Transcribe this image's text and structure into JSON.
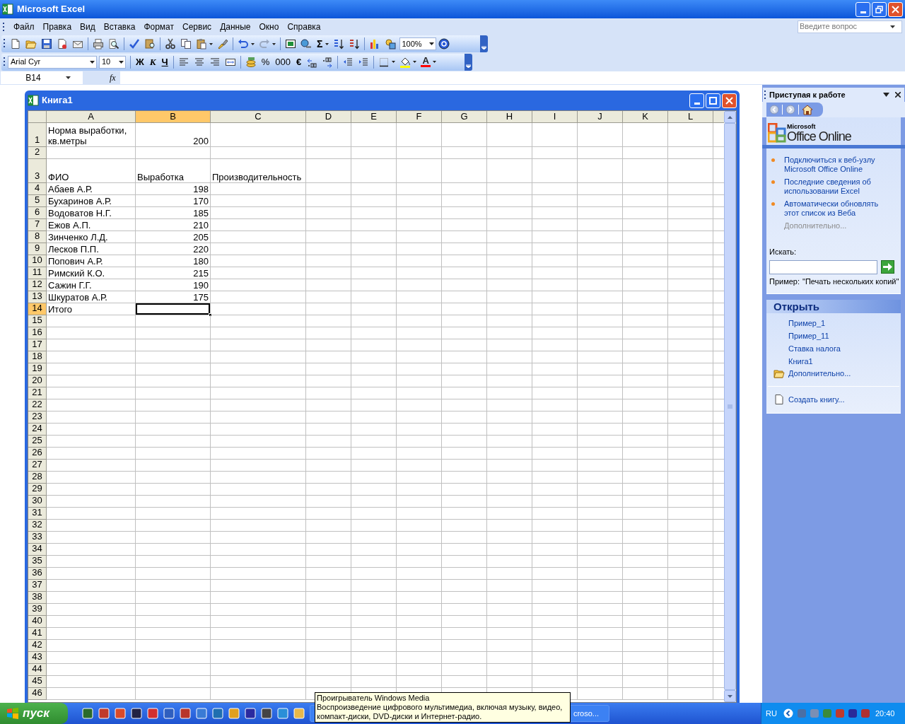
{
  "window": {
    "title": "Microsoft Excel"
  },
  "menu": [
    {
      "label": "Файл"
    },
    {
      "label": "Правка"
    },
    {
      "label": "Вид"
    },
    {
      "label": "Вставка"
    },
    {
      "label": "Формат"
    },
    {
      "label": "Сервис"
    },
    {
      "label": "Данные"
    },
    {
      "label": "Окно"
    },
    {
      "label": "Справка"
    }
  ],
  "help_search": {
    "placeholder": "Введите вопрос"
  },
  "standard_toolbar": {
    "autosum": "Σ",
    "zoom": "100%"
  },
  "formatting_toolbar": {
    "font": "Arial Cyr",
    "size": "10",
    "bold": "Ж",
    "italic": "К",
    "underline": "Ч",
    "percent": "%",
    "thousands": "000",
    "euro": "€",
    "font_color": "A"
  },
  "formula_bar": {
    "name_box": "B14",
    "function_label": "fx"
  },
  "workbook": {
    "title": "Книга1",
    "columns": [
      {
        "label": "A",
        "selected": false
      },
      {
        "label": "B",
        "selected": true
      },
      {
        "label": "C",
        "selected": false
      },
      {
        "label": "D",
        "selected": false
      },
      {
        "label": "E",
        "selected": false
      },
      {
        "label": "F",
        "selected": false
      },
      {
        "label": "G",
        "selected": false
      },
      {
        "label": "H",
        "selected": false
      },
      {
        "label": "I",
        "selected": false
      },
      {
        "label": "J",
        "selected": false
      },
      {
        "label": "K",
        "selected": false
      },
      {
        "label": "L",
        "selected": false
      }
    ],
    "rows": [
      {
        "header": "1",
        "tall": true,
        "selected": false,
        "cells": [
          {
            "text": "Норма выработки, кв.метры",
            "kind": "text"
          },
          {
            "text": "200",
            "kind": "number"
          }
        ]
      },
      {
        "header": "2",
        "tall": false,
        "selected": false
      },
      {
        "header": "3",
        "tall": true,
        "selected": false,
        "cells": [
          {
            "text": "ФИО",
            "kind": "text"
          },
          {
            "text": "Выработка",
            "kind": "text"
          },
          {
            "text": "Производительность",
            "kind": "text"
          }
        ]
      },
      {
        "header": "4",
        "tall": false,
        "selected": false,
        "cells": [
          {
            "text": "Абаев А.Р.",
            "kind": "text"
          },
          {
            "text": "198",
            "kind": "number"
          }
        ]
      },
      {
        "header": "5",
        "tall": false,
        "selected": false,
        "cells": [
          {
            "text": "Бухаринов А.Р.",
            "kind": "text"
          },
          {
            "text": "170",
            "kind": "number"
          }
        ]
      },
      {
        "header": "6",
        "tall": false,
        "selected": false,
        "cells": [
          {
            "text": "Водоватов Н.Г.",
            "kind": "text"
          },
          {
            "text": "185",
            "kind": "number"
          }
        ]
      },
      {
        "header": "7",
        "tall": false,
        "selected": false,
        "cells": [
          {
            "text": "Ежов А.П.",
            "kind": "text"
          },
          {
            "text": "210",
            "kind": "number"
          }
        ]
      },
      {
        "header": "8",
        "tall": false,
        "selected": false,
        "cells": [
          {
            "text": "Зинченко Л.Д.",
            "kind": "text"
          },
          {
            "text": "205",
            "kind": "number"
          }
        ]
      },
      {
        "header": "9",
        "tall": false,
        "selected": false,
        "cells": [
          {
            "text": "Лесков П.П.",
            "kind": "text"
          },
          {
            "text": "220",
            "kind": "number"
          }
        ]
      },
      {
        "header": "10",
        "tall": false,
        "selected": false,
        "cells": [
          {
            "text": "Попович А.Р.",
            "kind": "text"
          },
          {
            "text": "180",
            "kind": "number"
          }
        ]
      },
      {
        "header": "11",
        "tall": false,
        "selected": false,
        "cells": [
          {
            "text": "Римский К.О.",
            "kind": "text"
          },
          {
            "text": "215",
            "kind": "number"
          }
        ]
      },
      {
        "header": "12",
        "tall": false,
        "selected": false,
        "cells": [
          {
            "text": "Сажин Г.Г.",
            "kind": "text"
          },
          {
            "text": "190",
            "kind": "number"
          }
        ]
      },
      {
        "header": "13",
        "tall": false,
        "selected": false,
        "cells": [
          {
            "text": "Шкуратов А.Р.",
            "kind": "text"
          },
          {
            "text": "175",
            "kind": "number"
          }
        ]
      },
      {
        "header": "14",
        "tall": false,
        "selected": true,
        "cells": [
          {
            "text": "Итого",
            "kind": "text"
          }
        ]
      },
      {
        "header": "15",
        "tall": false,
        "selected": false
      },
      {
        "header": "16",
        "tall": false,
        "selected": false
      },
      {
        "header": "17",
        "tall": false,
        "selected": false
      },
      {
        "header": "18",
        "tall": false,
        "selected": false
      },
      {
        "header": "19",
        "tall": false,
        "selected": false
      },
      {
        "header": "20",
        "tall": false,
        "selected": false
      },
      {
        "header": "21",
        "tall": false,
        "selected": false
      },
      {
        "header": "22",
        "tall": false,
        "selected": false
      },
      {
        "header": "23",
        "tall": false,
        "selected": false
      },
      {
        "header": "24",
        "tall": false,
        "selected": false
      },
      {
        "header": "25",
        "tall": false,
        "selected": false
      },
      {
        "header": "26",
        "tall": false,
        "selected": false
      },
      {
        "header": "27",
        "tall": false,
        "selected": false
      },
      {
        "header": "28",
        "tall": false,
        "selected": false
      },
      {
        "header": "29",
        "tall": false,
        "selected": false
      },
      {
        "header": "30",
        "tall": false,
        "selected": false
      },
      {
        "header": "31",
        "tall": false,
        "selected": false
      },
      {
        "header": "32",
        "tall": false,
        "selected": false
      },
      {
        "header": "33",
        "tall": false,
        "selected": false
      },
      {
        "header": "34",
        "tall": false,
        "selected": false
      },
      {
        "header": "35",
        "tall": false,
        "selected": false
      },
      {
        "header": "36",
        "tall": false,
        "selected": false
      },
      {
        "header": "37",
        "tall": false,
        "selected": false
      },
      {
        "header": "38",
        "tall": false,
        "selected": false
      },
      {
        "header": "39",
        "tall": false,
        "selected": false
      },
      {
        "header": "40",
        "tall": false,
        "selected": false
      },
      {
        "header": "41",
        "tall": false,
        "selected": false
      },
      {
        "header": "42",
        "tall": false,
        "selected": false
      },
      {
        "header": "43",
        "tall": false,
        "selected": false
      },
      {
        "header": "44",
        "tall": false,
        "selected": false
      },
      {
        "header": "45",
        "tall": false,
        "selected": false
      },
      {
        "header": "46",
        "tall": false,
        "selected": false
      }
    ]
  },
  "task_pane": {
    "title": "Приступая к работе",
    "logo_brand": "Microsoft",
    "logo_name": "Office Online",
    "links": [
      {
        "label": "Подключиться к веб-узлу Microsoft Office Online",
        "disabled": false
      },
      {
        "label": "Последние сведения об использовании Excel",
        "disabled": false
      },
      {
        "label": "Автоматически обновлять этот список из Веба",
        "disabled": false
      },
      {
        "label": "Дополнительно...",
        "disabled": true
      }
    ],
    "search_label": "Искать:",
    "example_label": "Пример:",
    "example_text": "\"Печать нескольких копий\"",
    "open_header": "Открыть",
    "files": [
      {
        "label": "Пример_1"
      },
      {
        "label": "Пример_11"
      },
      {
        "label": "Ставка налога"
      },
      {
        "label": "Книга1"
      }
    ],
    "more_files": "Дополнительно...",
    "create": "Создать книгу..."
  },
  "taskbar": {
    "start": "пуск",
    "task": "croso...",
    "language": "RU",
    "clock": "20:40"
  },
  "tooltip": {
    "title": "Проигрыватель Windows Media",
    "text": "Воспроизведение цифрового мультимедиа, включая музыку, видео, компакт-диски, DVD-диски и Интернет-радио."
  }
}
